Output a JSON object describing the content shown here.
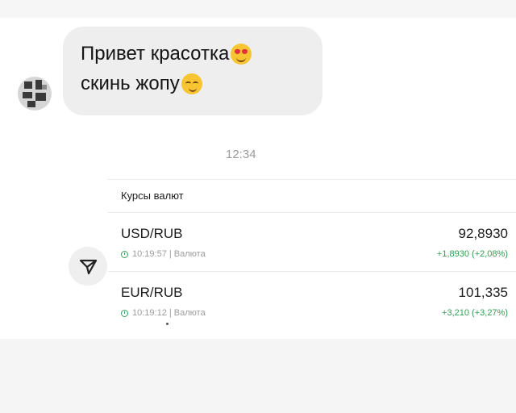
{
  "message": {
    "line1": "Привет красотка",
    "line2": "скинь жопу",
    "emoji1": "smiling-face-with-heart-eyes-emoji",
    "emoji2": "smirking-face-emoji",
    "time": "12:34"
  },
  "rates_card": {
    "title": "Курсы валют",
    "rows": [
      {
        "pair": "USD/RUB",
        "time": "10:19:57",
        "source": "Валюта",
        "meta": "10:19:57 | Валюта",
        "price": "92,8930",
        "change": "+1,8930 (+2,08%)"
      },
      {
        "pair": "EUR/RUB",
        "time": "10:19:12",
        "source": "Валюта",
        "meta": "10:19:12 | Валюта",
        "price": "101,335",
        "change": "+3,210 (+3,27%)"
      }
    ]
  },
  "icons": {
    "share": "share-arrow-icon",
    "clock": "clock-icon",
    "avatar": "avatar"
  },
  "colors": {
    "bubble": "#eeeeee",
    "positive_change": "#2f9e4f",
    "clock": "#3aa35a",
    "timestamp": "#9a9a9a"
  }
}
